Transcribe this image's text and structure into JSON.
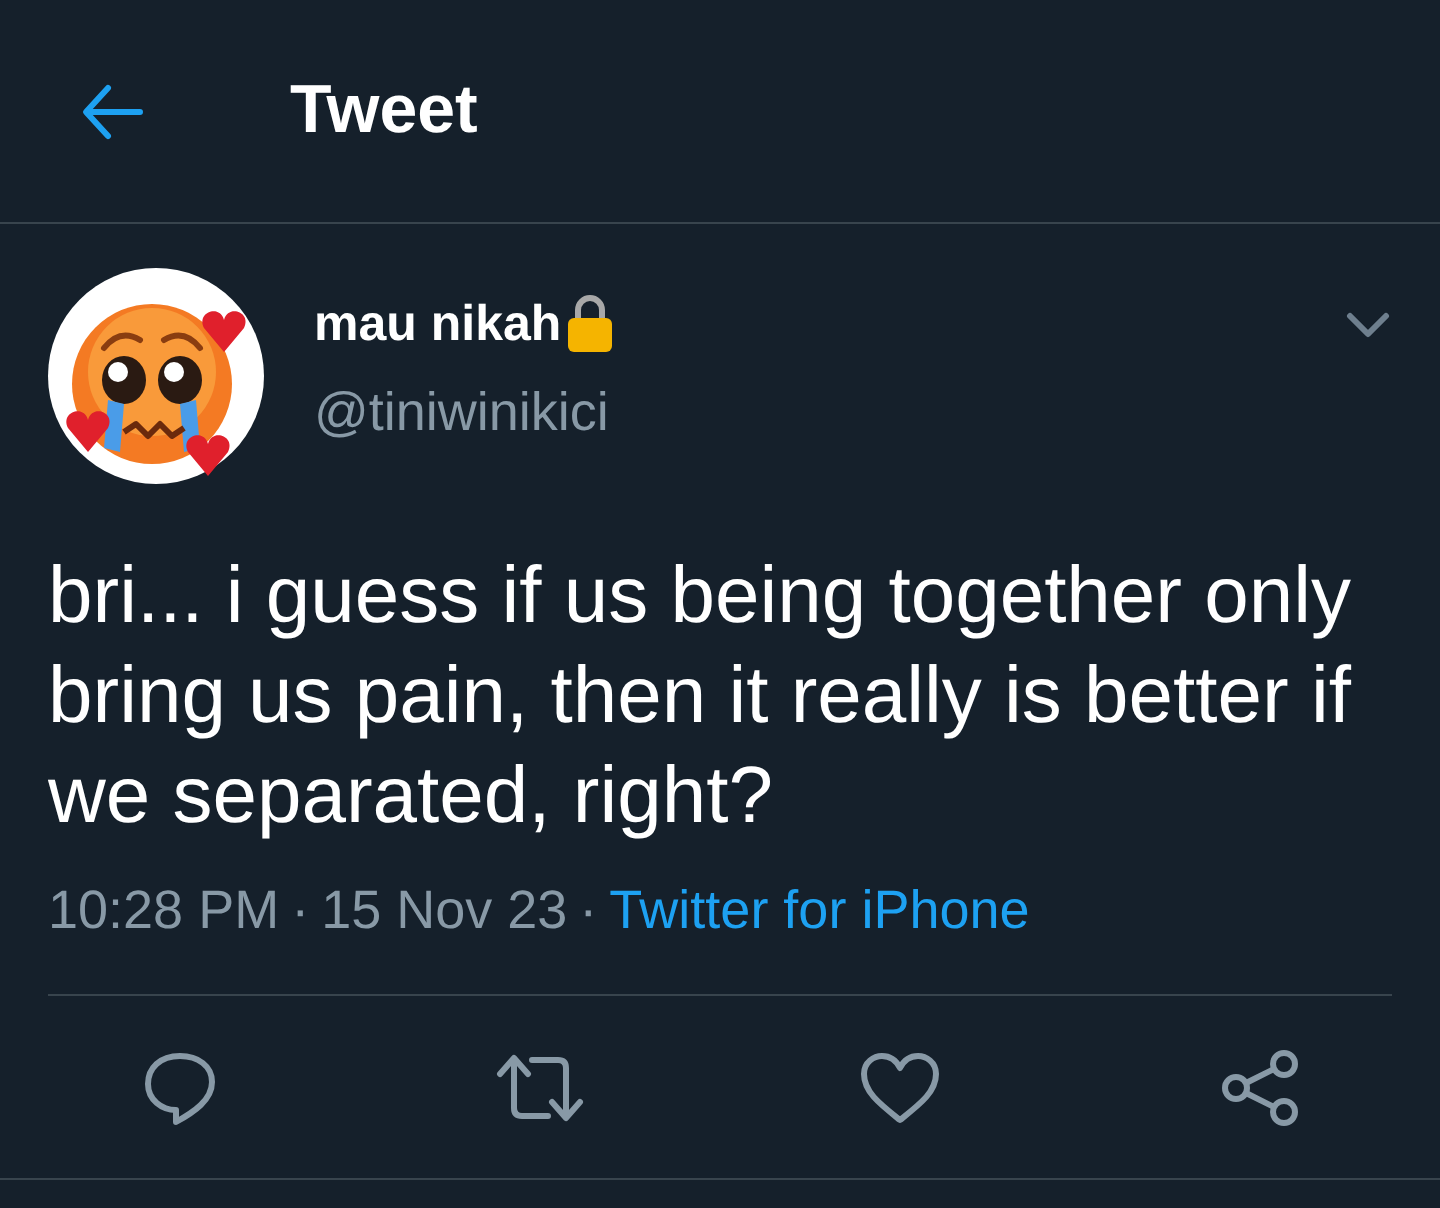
{
  "header": {
    "title": "Tweet"
  },
  "author": {
    "name": "mau nikah",
    "handle": "@tiniwinikici"
  },
  "tweet": {
    "text": "bri... i guess if us being together only bring us pain, then it really is better if we separated, right?"
  },
  "meta": [
    {
      "kind": "text",
      "text": "10:28 PM"
    },
    {
      "kind": "separator",
      "text": "·"
    },
    {
      "kind": "text",
      "text": "15 Nov 23"
    },
    {
      "kind": "separator",
      "text": "·"
    },
    {
      "kind": "link",
      "text": "Twitter for iPhone"
    }
  ]
}
